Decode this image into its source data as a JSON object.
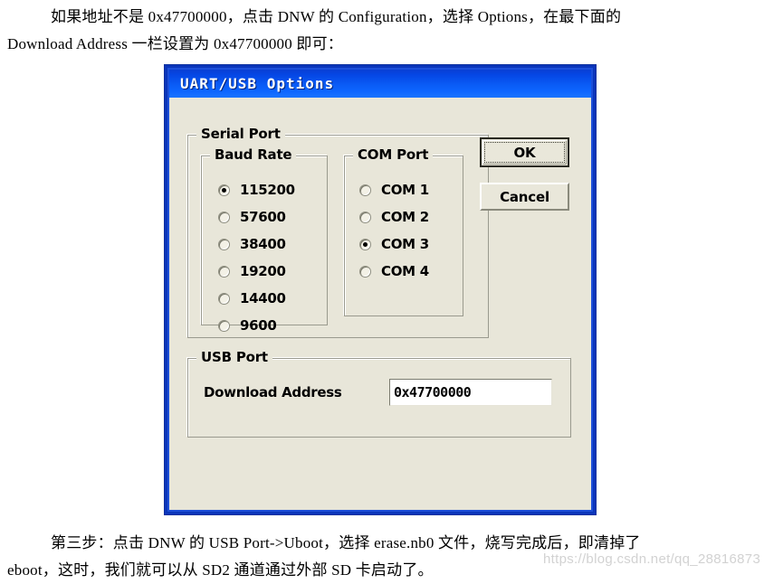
{
  "document": {
    "paragraph_above": [
      "如果地址不是 0x47700000，点击 DNW 的 Configuration，选择 Options，在最下面的",
      "Download Address 一栏设置为 0x47700000 即可："
    ],
    "paragraph_below": [
      "第三步：点击 DNW 的 USB Port->Uboot，选择 erase.nb0 文件，烧写完成后，即清掉了",
      "eboot，这时，我们就可以从 SD2 通道通过外部 SD 卡启动了。"
    ],
    "watermark": "https://blog.csdn.net/qq_28816873"
  },
  "dialog": {
    "title": "UART/USB Options",
    "colors": {
      "titlebar_top": "#0a3fd4",
      "titlebar_bottom": "#1a74ff",
      "frame_border": "#0b36ba",
      "client_face": "#e8e6d9"
    },
    "serial_port": {
      "legend": "Serial Port",
      "baud_rate": {
        "legend": "Baud Rate",
        "selected": "115200",
        "options": [
          {
            "label": "115200",
            "selected": true
          },
          {
            "label": "57600",
            "selected": false
          },
          {
            "label": "38400",
            "selected": false
          },
          {
            "label": "19200",
            "selected": false
          },
          {
            "label": "14400",
            "selected": false
          },
          {
            "label": "9600",
            "selected": false
          }
        ]
      },
      "com_port": {
        "legend": "COM Port",
        "selected": "COM 3",
        "options": [
          {
            "label": "COM 1",
            "selected": false
          },
          {
            "label": "COM 2",
            "selected": false
          },
          {
            "label": "COM 3",
            "selected": true
          },
          {
            "label": "COM 4",
            "selected": false
          }
        ]
      }
    },
    "usb_port": {
      "legend": "USB Port",
      "download_address_label": "Download Address",
      "download_address_value": "0x47700000"
    },
    "buttons": {
      "ok": "OK",
      "cancel": "Cancel"
    }
  }
}
